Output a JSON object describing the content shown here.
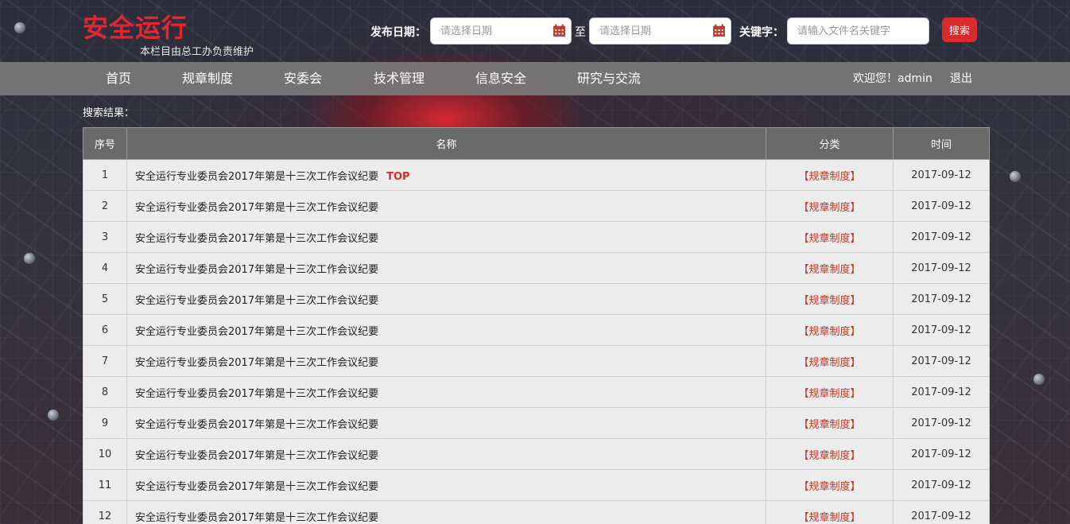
{
  "header": {
    "logo": "安全运行",
    "subtitle": "本栏目由总工办负责维护",
    "date_label": "发布日期：",
    "date_start_placeholder": "请选择日期",
    "date_sep": "至",
    "date_end_placeholder": "请选择日期",
    "keyword_label": "关键字：",
    "keyword_placeholder": "请输入文件名关键字",
    "search_label": "搜索"
  },
  "nav": {
    "items": [
      "首页",
      "规章制度",
      "安委会",
      "技术管理",
      "信息安全",
      "研究与交流"
    ],
    "welcome": "欢迎您！admin",
    "logout": "退出"
  },
  "results": {
    "label": "搜索结果：",
    "columns": [
      "序号",
      "名称",
      "分类",
      "时间"
    ],
    "top_tag": "TOP",
    "rows": [
      {
        "no": "1",
        "name": "安全运行专业委员会2017年第是十三次工作会议纪要",
        "category": "【规章制度】",
        "date": "2017-09-12",
        "top": true
      },
      {
        "no": "2",
        "name": "安全运行专业委员会2017年第是十三次工作会议纪要",
        "category": "【规章制度】",
        "date": "2017-09-12"
      },
      {
        "no": "3",
        "name": "安全运行专业委员会2017年第是十三次工作会议纪要",
        "category": "【规章制度】",
        "date": "2017-09-12"
      },
      {
        "no": "4",
        "name": "安全运行专业委员会2017年第是十三次工作会议纪要",
        "category": "【规章制度】",
        "date": "2017-09-12"
      },
      {
        "no": "5",
        "name": "安全运行专业委员会2017年第是十三次工作会议纪要",
        "category": "【规章制度】",
        "date": "2017-09-12"
      },
      {
        "no": "6",
        "name": "安全运行专业委员会2017年第是十三次工作会议纪要",
        "category": "【规章制度】",
        "date": "2017-09-12"
      },
      {
        "no": "7",
        "name": "安全运行专业委员会2017年第是十三次工作会议纪要",
        "category": "【规章制度】",
        "date": "2017-09-12"
      },
      {
        "no": "8",
        "name": "安全运行专业委员会2017年第是十三次工作会议纪要",
        "category": "【规章制度】",
        "date": "2017-09-12"
      },
      {
        "no": "9",
        "name": "安全运行专业委员会2017年第是十三次工作会议纪要",
        "category": "【规章制度】",
        "date": "2017-09-12"
      },
      {
        "no": "10",
        "name": "安全运行专业委员会2017年第是十三次工作会议纪要",
        "category": "【规章制度】",
        "date": "2017-09-12"
      },
      {
        "no": "11",
        "name": "安全运行专业委员会2017年第是十三次工作会议纪要",
        "category": "【规章制度】",
        "date": "2017-09-12"
      },
      {
        "no": "12",
        "name": "安全运行专业委员会2017年第是十三次工作会议纪要",
        "category": "【规章制度】",
        "date": "2017-09-12"
      }
    ]
  },
  "colors": {
    "accent": "#e3262f",
    "category": "#c0392b",
    "nav_bg": "#787878",
    "header_cell": "#6a6a6a"
  }
}
